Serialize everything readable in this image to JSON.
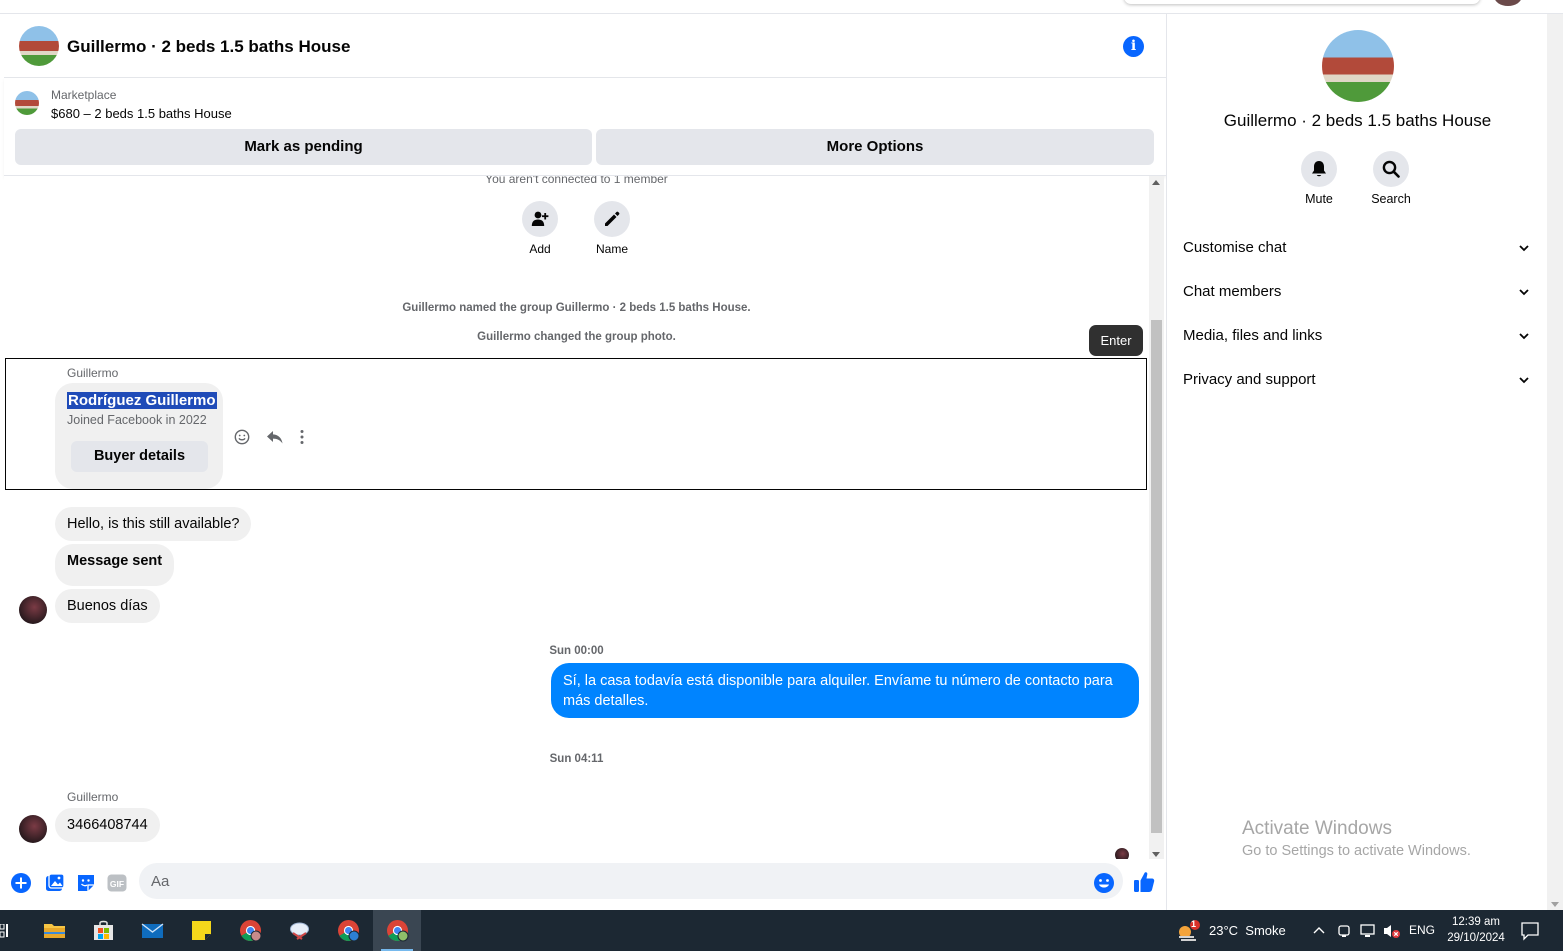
{
  "header": {
    "title": "Guillermo · 2 beds 1.5 baths House"
  },
  "marketplace": {
    "label": "Marketplace",
    "listing": "$680 – 2 beds 1.5 baths House",
    "mark_pending": "Mark as pending",
    "more_options": "More Options"
  },
  "chat": {
    "not_connected": "You aren't connected to 1 member",
    "actions": [
      {
        "label": "Add",
        "icon": "add-person-icon"
      },
      {
        "label": "Name",
        "icon": "pencil-icon"
      }
    ],
    "system_messages": [
      "Guillermo named the group Guillermo · 2 beds 1.5 baths House.",
      "Guillermo changed the group photo."
    ],
    "tooltip": "Enter",
    "buyer_card": {
      "sender": "Guillermo",
      "name": "Rodríguez Guillermo",
      "joined": "Joined Facebook in 2022",
      "button": "Buyer details"
    },
    "messages": {
      "m1": "Hello, is this still available?",
      "m2": "Message sent",
      "m3": "Buenos días",
      "ts1": "Sun 00:00",
      "out1": "Sí, la casa todavía está disponible para alquiler. Envíame tu número de contacto para más detalles.",
      "ts2": "Sun 04:11",
      "sender2": "Guillermo",
      "m4": "3466408744"
    }
  },
  "composer": {
    "placeholder": "Aa"
  },
  "right_panel": {
    "title": "Guillermo · 2 beds 1.5 baths House",
    "mute": "Mute",
    "search": "Search",
    "rows": [
      "Customise chat",
      "Chat members",
      "Media, files and links",
      "Privacy and support"
    ],
    "activate_title": "Activate Windows",
    "activate_sub": "Go to Settings to activate Windows."
  },
  "taskbar": {
    "weather": "23°C  Smoke",
    "weather_badge": "1",
    "lang": "ENG",
    "time": "12:39 am",
    "date": "29/10/2024"
  },
  "colors": {
    "messenger_blue": "#0084ff",
    "facebook_blue": "#0866ff",
    "bubble_grey": "#f0f0f0",
    "taskbar": "#1c2833"
  }
}
